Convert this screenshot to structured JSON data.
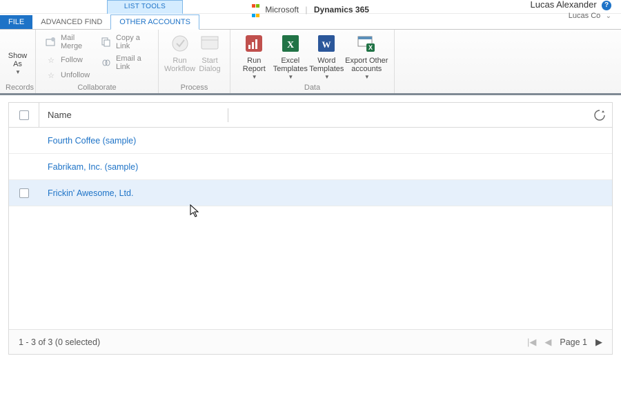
{
  "brand": {
    "ms": "Microsoft",
    "product": "Dynamics 365"
  },
  "user": {
    "name": "Lucas Alexander",
    "org": "Lucas Co"
  },
  "context_tab": "LIST TOOLS",
  "tabs": {
    "file": "FILE",
    "advanced_find": "ADVANCED FIND",
    "other_accounts": "OTHER ACCOUNTS"
  },
  "ribbon": {
    "records": {
      "group_label": "Records",
      "show_as": "Show\nAs"
    },
    "collaborate": {
      "group_label": "Collaborate",
      "mail_merge": "Mail Merge",
      "follow": "Follow",
      "unfollow": "Unfollow",
      "copy_link": "Copy a Link",
      "email_link": "Email a Link"
    },
    "process": {
      "group_label": "Process",
      "run_workflow": "Run\nWorkflow",
      "start_dialog": "Start\nDialog"
    },
    "data": {
      "group_label": "Data",
      "run_report": "Run\nReport",
      "excel_templates": "Excel\nTemplates",
      "word_templates": "Word\nTemplates",
      "export_other": "Export Other\naccounts"
    }
  },
  "grid": {
    "header_name": "Name",
    "rows": [
      {
        "name": "Fourth Coffee (sample)"
      },
      {
        "name": "Fabrikam, Inc. (sample)"
      },
      {
        "name": "Frickin' Awesome, Ltd."
      }
    ],
    "hover_index": 2,
    "status": "1 - 3 of 3 (0 selected)",
    "page_label": "Page 1"
  }
}
